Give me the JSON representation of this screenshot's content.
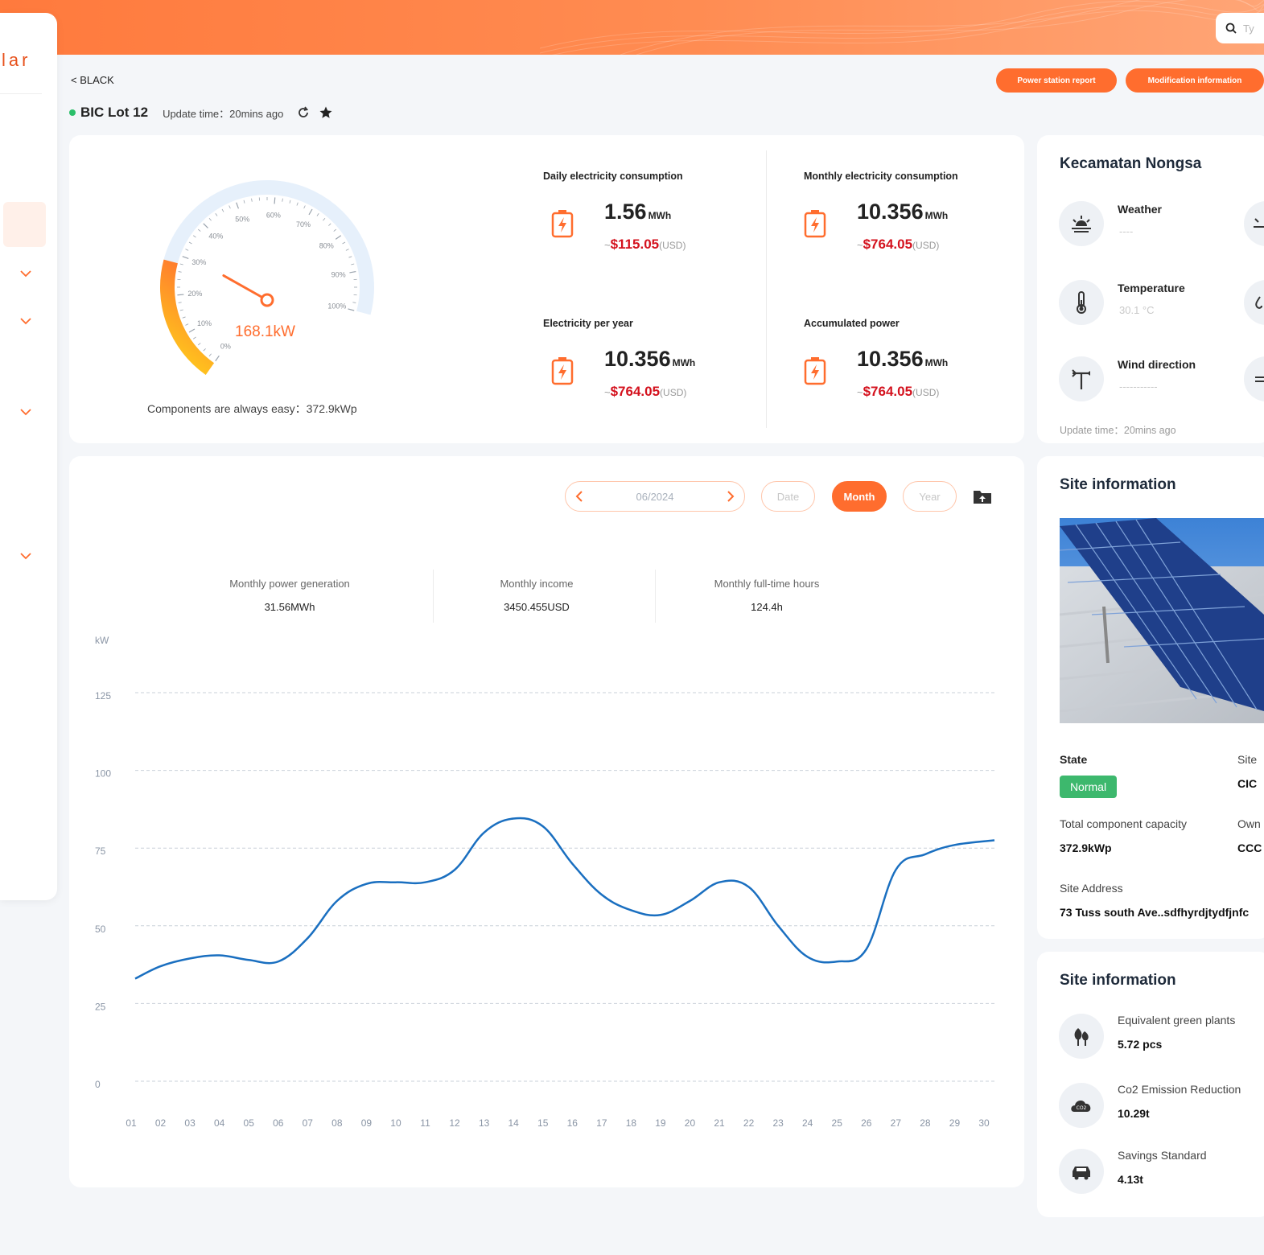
{
  "header": {
    "search_placeholder": "Ty",
    "logo_text": "lar"
  },
  "breadcrumb": {
    "back_label": "< BLACK"
  },
  "site": {
    "name": "BIC Lot 12",
    "update_text": "Update time：20mins ago",
    "status_color": "#2bbf6a"
  },
  "actions": {
    "power_report": "Power station report",
    "modification": "Modification information"
  },
  "gauge": {
    "value_text": "168.1kW",
    "percent": 0.28,
    "ticks": [
      "0%",
      "10%",
      "20%",
      "30%",
      "40%",
      "50%",
      "60%",
      "70%",
      "80%",
      "90%",
      "100%"
    ],
    "components_text": "Components are always easy：372.9kWp"
  },
  "stats": {
    "daily": {
      "label": "Daily electricity consumption",
      "value": "1.56",
      "unit": "MWh",
      "tilde": "~",
      "money": "$115.05",
      "currency": "(USD)"
    },
    "monthly": {
      "label": "Monthly electricity consumption",
      "value": "10.356",
      "unit": "MWh",
      "tilde": "~",
      "money": "$764.05",
      "currency": "(USD)"
    },
    "yearly": {
      "label": "Electricity per year",
      "value": "10.356",
      "unit": "MWh",
      "tilde": "~",
      "money": "$764.05",
      "currency": "(USD)"
    },
    "accum": {
      "label": "Accumulated power",
      "value": "10.356",
      "unit": "MWh",
      "tilde": "~",
      "money": "$764.05",
      "currency": "(USD)"
    }
  },
  "location": {
    "title": "Kecamatan Nongsa",
    "weather_label": "Weather",
    "weather_value": "----",
    "temperature_label": "Temperature",
    "temperature_value": "30.1 °C",
    "wind_label": "Wind direction",
    "wind_value": "-----------",
    "update_text": "Update time：20mins ago"
  },
  "chart_controls": {
    "date_value": "06/2024",
    "date_tab": "Date",
    "month_tab": "Month",
    "year_tab": "Year",
    "active_tab": "Month"
  },
  "summary": {
    "generation_label": "Monthly power generation",
    "generation_value": "31.56MWh",
    "income_label": "Monthly income",
    "income_value": "3450.455USD",
    "hours_label": "Monthly full-time hours",
    "hours_value": "124.4h"
  },
  "chart_data": {
    "type": "line",
    "title": "",
    "xlabel": "",
    "ylabel": "kW",
    "ylim": [
      0,
      125
    ],
    "yticks": [
      0,
      25,
      50,
      75,
      100,
      125
    ],
    "categories": [
      "01",
      "02",
      "03",
      "04",
      "05",
      "06",
      "07",
      "08",
      "09",
      "10",
      "11",
      "12",
      "13",
      "14",
      "15",
      "16",
      "17",
      "18",
      "19",
      "20",
      "21",
      "22",
      "23",
      "24",
      "25",
      "26",
      "27",
      "28",
      "29",
      "30"
    ],
    "series": [
      {
        "values": [
          33,
          37,
          39.5,
          40.5,
          39,
          38.5,
          46,
          58,
          63.5,
          64,
          64,
          68,
          80,
          84.5,
          82,
          70,
          60,
          55,
          53.5,
          58,
          64,
          62.5,
          50,
          40,
          38.5,
          42.5,
          68,
          73,
          76,
          77.5
        ],
        "color": "#1a6fc0"
      }
    ],
    "grid": true,
    "grid_style": "dashed"
  },
  "site_info": {
    "title": "Site information",
    "state_label": "State",
    "state_value": "Normal",
    "site_label": "Site",
    "site_value": "CIC",
    "capacity_label": "Total component capacity",
    "capacity_value": "372.9kWp",
    "owner_label": "Own",
    "owner_value": "CCC",
    "address_label": "Site Address",
    "address_value": "73 Tuss south Ave..sdfhyrdjtydfjnfc"
  },
  "green": {
    "title": "Site information",
    "plants_label": "Equivalent green plants",
    "plants_value": "5.72 pcs",
    "co2_label": "Co2 Emission Reduction",
    "co2_value": "10.29t",
    "savings_label": "Savings Standard",
    "savings_value": "4.13t"
  },
  "colors": {
    "accent": "#ff6d2e",
    "money": "#d4121e",
    "line": "#1a6fc0",
    "normal": "#3db86d"
  }
}
